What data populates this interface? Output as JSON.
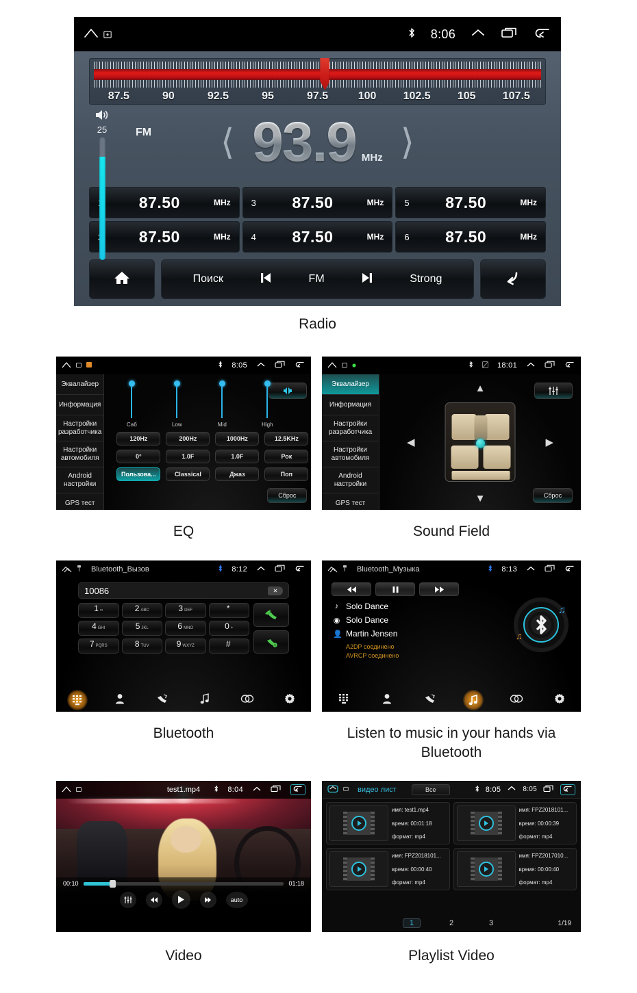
{
  "radio": {
    "statusbar": {
      "time": "8:06",
      "icons": [
        "home-icon",
        "screenshot-icon",
        "bluetooth-icon",
        "chevron-up-icon",
        "recents-icon",
        "back-icon"
      ]
    },
    "scale_ticks": [
      "87.5",
      "90",
      "92.5",
      "95",
      "97.5",
      "100",
      "102.5",
      "105",
      "107.5"
    ],
    "volume_label": "25",
    "band": "FM",
    "frequency": "93.9",
    "frequency_unit": "MHz",
    "presets": [
      {
        "num": "1",
        "value": "87.50",
        "unit": "MHz"
      },
      {
        "num": "3",
        "value": "87.50",
        "unit": "MHz"
      },
      {
        "num": "5",
        "value": "87.50",
        "unit": "MHz"
      },
      {
        "num": "2",
        "value": "87.50",
        "unit": "MHz"
      },
      {
        "num": "4",
        "value": "87.50",
        "unit": "MHz"
      },
      {
        "num": "6",
        "value": "87.50",
        "unit": "MHz"
      }
    ],
    "bottom": {
      "search": "Поиск",
      "band": "FM",
      "strong": "Strong"
    },
    "caption": "Radio"
  },
  "eq": {
    "statusbar": {
      "time": "8:05"
    },
    "menu": [
      "Эквалайзер",
      "Информация",
      "Настройки разработчика",
      "Настройки автомобиля",
      "Android настройки",
      "GPS тест"
    ],
    "sliders": [
      {
        "label": "Саб"
      },
      {
        "label": "Low"
      },
      {
        "label": "Mid"
      },
      {
        "label": "High"
      }
    ],
    "buttons_row1": [
      "120Hz",
      "200Hz",
      "1000Hz",
      "12.5KHz"
    ],
    "buttons_row2": [
      "0°",
      "1.0F",
      "1.0F",
      "Рок"
    ],
    "buttons_row3": [
      "Пользова...",
      "Classical",
      "Джаз",
      "Поп"
    ],
    "active_preset": "Пользова...",
    "reset": "Сброс",
    "caption": "EQ"
  },
  "soundfield": {
    "statusbar": {
      "time": "18:01"
    },
    "menu": [
      "Эквалайзер",
      "Информация",
      "Настройки разработчика",
      "Настройки автомобиля",
      "Android настройки",
      "GPS тест"
    ],
    "active_menu": "Эквалайзер",
    "reset": "Сброс",
    "caption": "Sound Field"
  },
  "bluetooth": {
    "statusbar": {
      "title": "Bluetooth_Вызов",
      "time": "8:12"
    },
    "number": "10086",
    "keys": [
      {
        "digit": "1",
        "letters": "∞"
      },
      {
        "digit": "2",
        "letters": "ABC"
      },
      {
        "digit": "3",
        "letters": "DEF"
      },
      {
        "digit": "*",
        "letters": ""
      },
      {
        "digit": "4",
        "letters": "GHI"
      },
      {
        "digit": "5",
        "letters": "JKL"
      },
      {
        "digit": "6",
        "letters": "MNO"
      },
      {
        "digit": "0",
        "letters": "+"
      },
      {
        "digit": "7",
        "letters": "PQRS"
      },
      {
        "digit": "8",
        "letters": "TUV"
      },
      {
        "digit": "9",
        "letters": "WXYZ"
      },
      {
        "digit": "#",
        "letters": ""
      }
    ],
    "tabs": [
      "keypad-icon",
      "contacts-icon",
      "call-history-icon",
      "music-icon",
      "link-icon",
      "settings-icon"
    ],
    "active_tab": "keypad-icon",
    "caption": "Bluetooth"
  },
  "btmusic": {
    "statusbar": {
      "title": "Bluetooth_Музыка",
      "time": "8:13"
    },
    "controls": [
      "prev-icon",
      "pause-icon",
      "next-icon"
    ],
    "track": "Solo Dance",
    "album": "Solo Dance",
    "artist": "Martin Jensen",
    "status_a2dp": "A2DP соединено",
    "status_avrcp": "AVRCP соединено",
    "tabs": [
      "keypad-icon",
      "contacts-icon",
      "call-history-icon",
      "music-icon",
      "link-icon",
      "settings-icon"
    ],
    "active_tab": "music-icon",
    "caption": "Listen to music in your hands via Bluetooth"
  },
  "video": {
    "statusbar": {
      "title": "test1.mp4",
      "time": "8:04"
    },
    "time_current": "00:10",
    "time_total": "01:18",
    "progress_percent": 14,
    "controls": [
      "equalizer-icon",
      "prev-icon",
      "play-icon",
      "next-icon",
      "auto"
    ],
    "auto_label": "auto",
    "caption": "Video"
  },
  "playlist": {
    "statusbar": {
      "title": "видео лист",
      "filter": "Все",
      "time": "8:05",
      "time2": "8:05"
    },
    "items": [
      {
        "name_label": "имя:",
        "name": "test1.mp4",
        "time_label": "время:",
        "time": "00:01:18",
        "format_label": "формат:",
        "format": "mp4"
      },
      {
        "name_label": "имя:",
        "name": "FPZ2018101...",
        "time_label": "время:",
        "time": "00:00:39",
        "format_label": "формат:",
        "format": "mp4"
      },
      {
        "name_label": "имя:",
        "name": "FPZ2018101...",
        "time_label": "время:",
        "time": "00:00:40",
        "format_label": "формат:",
        "format": "mp4"
      },
      {
        "name_label": "имя:",
        "name": "FPZ2017010...",
        "time_label": "время:",
        "time": "00:00:40",
        "format_label": "формат:",
        "format": "mp4"
      }
    ],
    "pages": [
      "1",
      "2",
      "3"
    ],
    "active_page": "1",
    "page_total": "1/19",
    "caption": "Playlist Video"
  },
  "colors": {
    "radio_bg": "#46525f",
    "red_band": "#d01a17",
    "cyan": "#2ab4e8",
    "teal": "#0ea0a4",
    "amber": "#cf9323",
    "orange_glow": "#ffaa28"
  }
}
